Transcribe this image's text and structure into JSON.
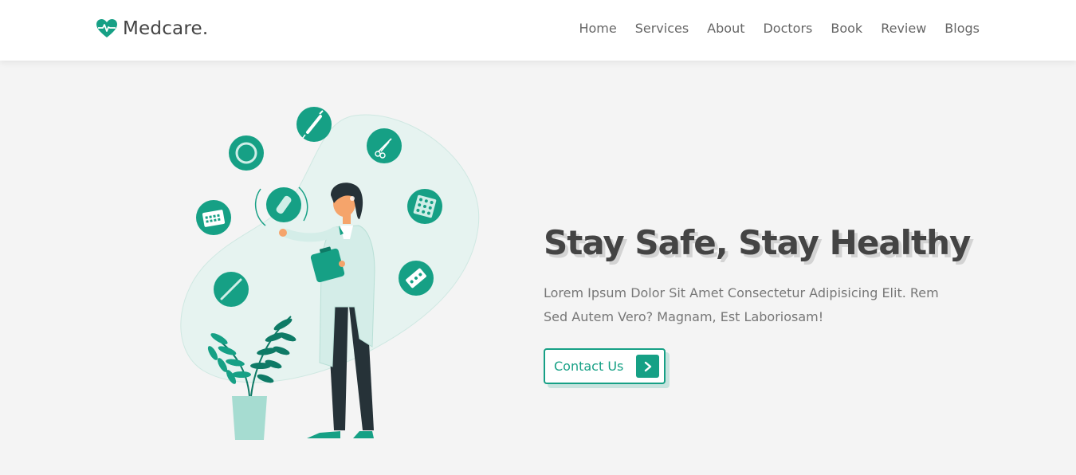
{
  "brand": {
    "name": "Medcare.",
    "accent": "#16a085",
    "icon": "heartbeat-icon"
  },
  "nav": {
    "items": [
      "Home",
      "Services",
      "About",
      "Doctors",
      "Book",
      "Review",
      "Blogs"
    ]
  },
  "hero": {
    "title": "Stay Safe, Stay Healthy",
    "description": "Lorem Ipsum Dolor Sit Amet Consectetur Adipisicing Elit. Rem Sed Autem Vero? Magnam, Est Laboriosam!",
    "cta_label": "Contact Us",
    "cta_icon": "chevron-right-icon"
  }
}
